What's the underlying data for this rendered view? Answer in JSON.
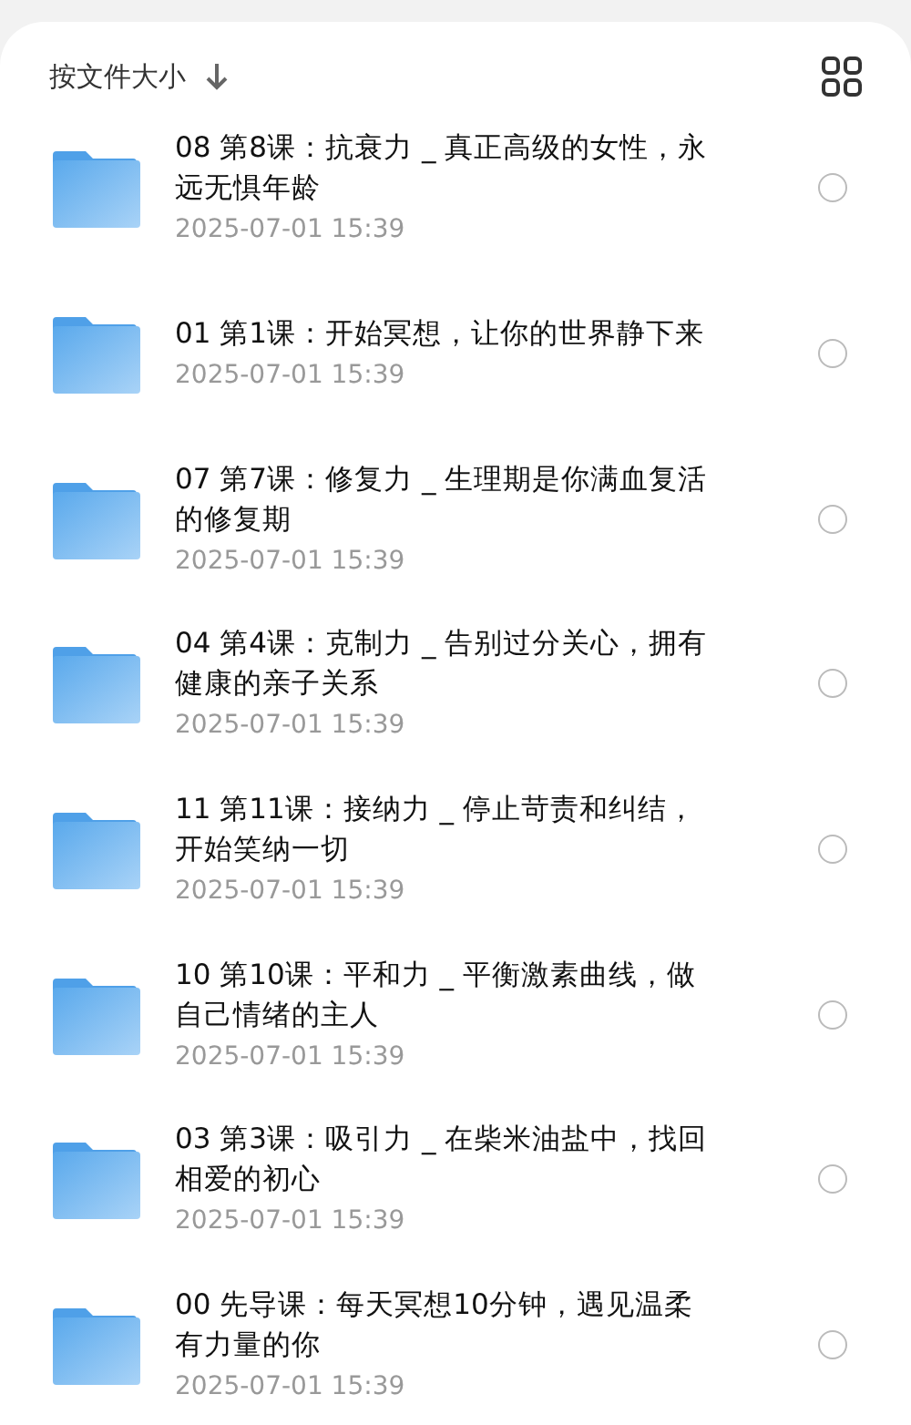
{
  "sort": {
    "label": "按文件大小"
  },
  "files": [
    {
      "name": "08 第8课：抗衰力 _ 真正高级的女性，永远无惧年龄",
      "date": "2025-07-01 15:39",
      "selected": false
    },
    {
      "name": "01 第1课：开始冥想，让你的世界静下来",
      "date": "2025-07-01 15:39",
      "selected": false
    },
    {
      "name": "07 第7课：修复力 _ 生理期是你满血复活的修复期",
      "date": "2025-07-01 15:39",
      "selected": false
    },
    {
      "name": "04 第4课：克制力 _ 告别过分关心，拥有健康的亲子关系",
      "date": "2025-07-01 15:39",
      "selected": false
    },
    {
      "name": "11 第11课：接纳力 _ 停止苛责和纠结，开始笑纳一切",
      "date": "2025-07-01 15:39",
      "selected": false
    },
    {
      "name": "10 第10课：平和力 _ 平衡激素曲线，做自己情绪的主人",
      "date": "2025-07-01 15:39",
      "selected": false
    },
    {
      "name": "03 第3课：吸引力 _ 在柴米油盐中，找回相爱的初心",
      "date": "2025-07-01 15:39",
      "selected": false
    },
    {
      "name": "00 先导课：每天冥想10分钟，遇见温柔有力量的你",
      "date": "2025-07-01 15:39",
      "selected": false
    }
  ]
}
